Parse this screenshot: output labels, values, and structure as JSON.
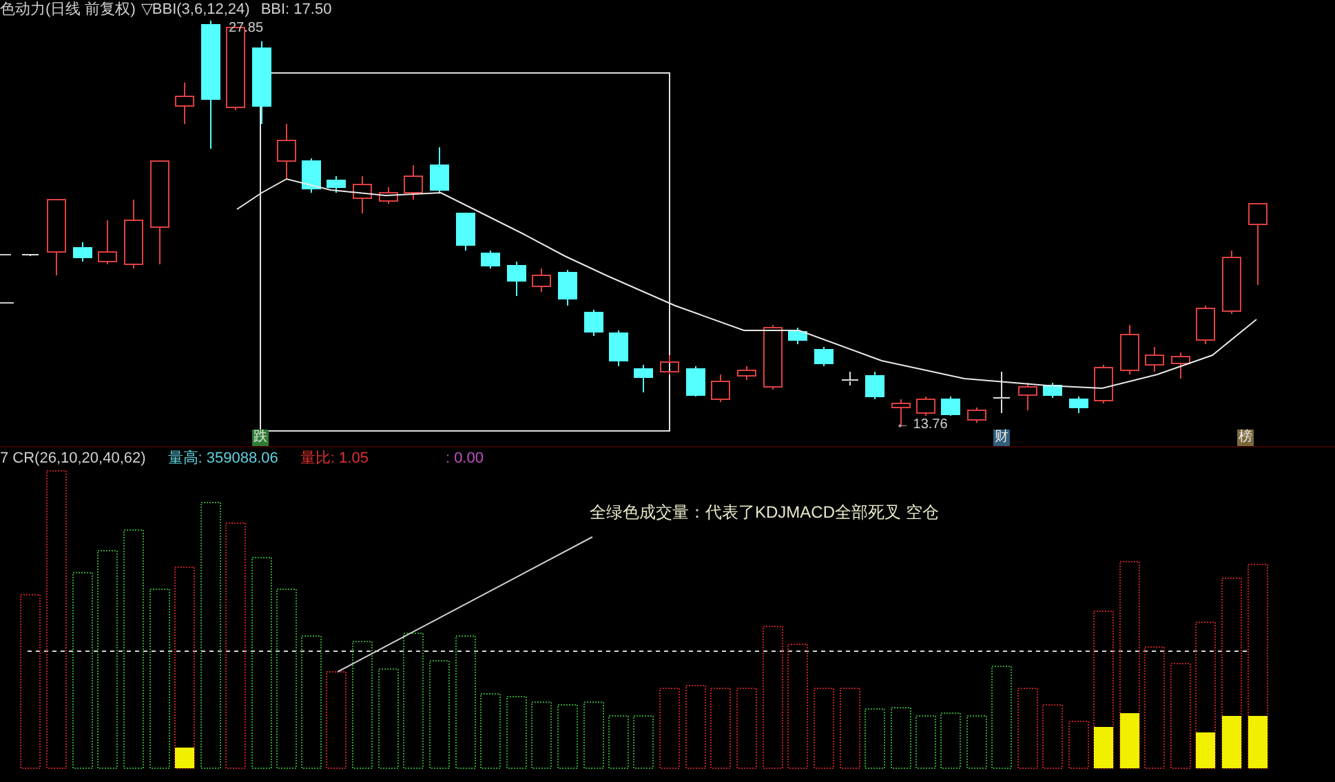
{
  "header": {
    "title": "色动力(日线 前复权)",
    "indicator": "▽BBI(3,6,12,24)",
    "reading": "BBI: 17.50"
  },
  "price_chart": {
    "high_label": "27.85",
    "low_label": "← 13.76",
    "markers": [
      {
        "label": "跌",
        "color": "#2e7d32"
      },
      {
        "label": "财",
        "color": "#2f5f7a"
      },
      {
        "label": "榜",
        "color": "#7a6a3a"
      }
    ]
  },
  "volume_panel": {
    "indicator": "7 CR(26,10,20,40,62)",
    "stats": [
      {
        "text": "量高: 359088.06",
        "color": "#5fd3e0"
      },
      {
        "text": "量比: 1.05",
        "color": "#e03030"
      },
      {
        "text": ": 0.00",
        "color": "#c050c0"
      }
    ],
    "annotation": "全绿色成交量：代表了KDJMACD全部死叉 空仓"
  }
}
